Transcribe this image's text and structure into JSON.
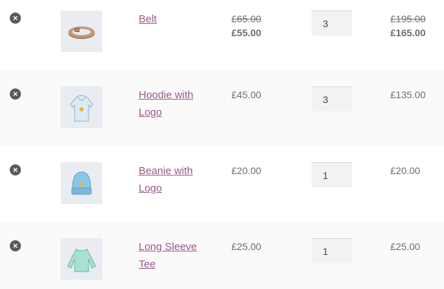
{
  "cart": {
    "items": [
      {
        "name": "Belt",
        "image_icon": "belt-icon",
        "price_old": "£65.00",
        "price": "£55.00",
        "quantity": "3",
        "subtotal_old": "£195.00",
        "subtotal": "£165.00"
      },
      {
        "name": "Hoodie with Logo",
        "image_icon": "hoodie-icon",
        "price": "£45.00",
        "quantity": "3",
        "subtotal": "£135.00"
      },
      {
        "name": "Beanie with Logo",
        "image_icon": "beanie-icon",
        "price": "£20.00",
        "quantity": "1",
        "subtotal": "£20.00"
      },
      {
        "name": "Long Sleeve Tee",
        "image_icon": "long-sleeve-tee-icon",
        "price": "£25.00",
        "quantity": "1",
        "subtotal": "£25.00"
      }
    ],
    "remove_symbol": "×",
    "colors": {
      "link": "#96588a",
      "text": "#6d6d6d",
      "alt_row": "#fafafa",
      "remove": "#5a5a5a"
    }
  }
}
